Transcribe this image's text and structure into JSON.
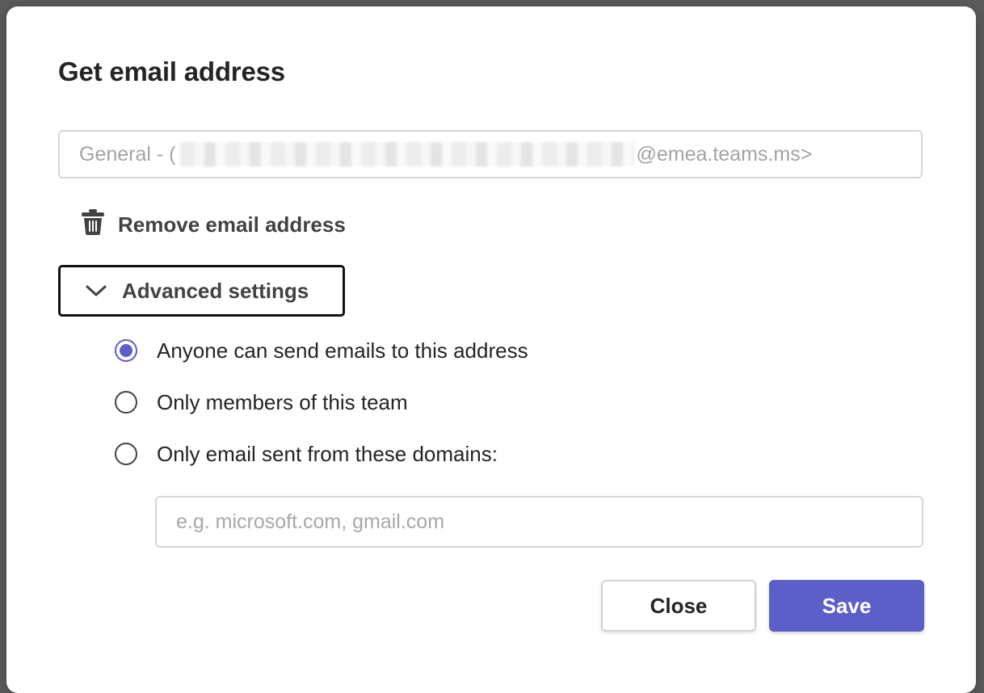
{
  "dialog": {
    "title": "Get email address",
    "email": {
      "prefix": "General - (",
      "suffix": "@emea.teams.ms>"
    },
    "remove_label": "Remove email address",
    "advanced_label": "Advanced settings",
    "options": [
      {
        "label": "Anyone can send emails to this address",
        "checked": true
      },
      {
        "label": "Only members of this team",
        "checked": false
      },
      {
        "label": "Only email sent from these domains:",
        "checked": false
      }
    ],
    "domains_placeholder": "e.g. microsoft.com, gmail.com",
    "close_label": "Close",
    "save_label": "Save"
  },
  "colors": {
    "accent": "#5b5fc7",
    "overlay": "#5c5c5c",
    "text_primary": "#242424",
    "text_placeholder": "#a3a3a3"
  },
  "icons": {
    "remove": "trash-icon",
    "advanced": "chevron-down-icon"
  }
}
